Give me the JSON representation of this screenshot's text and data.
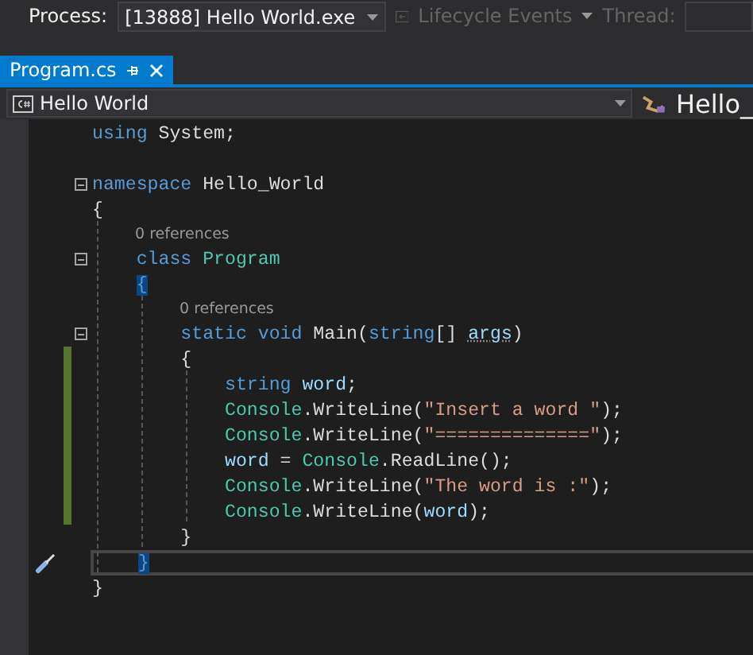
{
  "toolbar": {
    "process_label": "Process:",
    "process": "[13888] Hello World.exe",
    "lifecycle": {
      "label": "Lifecycle Events",
      "disabled": true
    },
    "thread_label": {
      "label": "Thread:",
      "disabled": true
    }
  },
  "tabs": [
    {
      "label": "Program.cs",
      "selected": true
    }
  ],
  "nav": {
    "project": "Hello World",
    "member": "Hello_"
  },
  "lines": [
    {
      "kind": "code",
      "tokens": [
        {
          "text": "using",
          "kind": "kw"
        },
        {
          "text": " System;",
          "kind": "id"
        }
      ]
    },
    {
      "kind": "blank"
    },
    {
      "kind": "code",
      "fold": true,
      "tokens": [
        {
          "text": "namespace",
          "kind": "kw"
        },
        {
          "text": " Hello_World",
          "kind": "id"
        }
      ]
    },
    {
      "kind": "code",
      "tokens": [
        {
          "text": "{",
          "kind": "id"
        }
      ]
    },
    {
      "kind": "lens",
      "text": "0 references"
    },
    {
      "kind": "code",
      "fold": true,
      "tokens": [
        {
          "text": "    class",
          "kind": "kw"
        },
        {
          "text": " Program",
          "kind": "type"
        }
      ]
    },
    {
      "kind": "code",
      "tokens": [
        {
          "text": "    {",
          "kind": "match"
        }
      ]
    },
    {
      "kind": "lens",
      "text": "0 references"
    },
    {
      "kind": "code",
      "fold": true,
      "tokens": [
        {
          "text": "        static void",
          "kind": "kw"
        },
        {
          "text": " Main(",
          "kind": "id"
        },
        {
          "text": "string",
          "kind": "kw"
        },
        {
          "text": "[] ",
          "kind": "id"
        },
        {
          "text": "args",
          "kind": "unused"
        },
        {
          "text": ")",
          "kind": "id"
        }
      ]
    },
    {
      "kind": "code",
      "changed": true,
      "tokens": [
        {
          "text": "        {",
          "kind": "id"
        }
      ]
    },
    {
      "kind": "code",
      "changed": true,
      "tokens": [
        {
          "text": "            string",
          "kind": "kw"
        },
        {
          "text": " word",
          "kind": "local"
        },
        {
          "text": ";",
          "kind": "id"
        }
      ]
    },
    {
      "kind": "code",
      "changed": true,
      "tokens": [
        {
          "text": "            Console",
          "kind": "type"
        },
        {
          "text": ".WriteLine(",
          "kind": "id"
        },
        {
          "text": "\"Insert a word \"",
          "kind": "str"
        },
        {
          "text": ");",
          "kind": "id"
        }
      ]
    },
    {
      "kind": "code",
      "changed": true,
      "tokens": [
        {
          "text": "            Console",
          "kind": "type"
        },
        {
          "text": ".WriteLine(",
          "kind": "id"
        },
        {
          "text": "\"==============\"",
          "kind": "str"
        },
        {
          "text": ");",
          "kind": "id"
        }
      ]
    },
    {
      "kind": "code",
      "changed": true,
      "tokens": [
        {
          "text": "            word",
          "kind": "local"
        },
        {
          "text": " = ",
          "kind": "id"
        },
        {
          "text": "Console",
          "kind": "type"
        },
        {
          "text": ".ReadLine();",
          "kind": "id"
        }
      ]
    },
    {
      "kind": "code",
      "changed": true,
      "tokens": [
        {
          "text": "            Console",
          "kind": "type"
        },
        {
          "text": ".WriteLine(",
          "kind": "id"
        },
        {
          "text": "\"The word is :\"",
          "kind": "str"
        },
        {
          "text": ");",
          "kind": "id"
        }
      ]
    },
    {
      "kind": "code",
      "changed": true,
      "tokens": [
        {
          "text": "            Console",
          "kind": "type"
        },
        {
          "text": ".WriteLine(",
          "kind": "id"
        },
        {
          "text": "word",
          "kind": "local"
        },
        {
          "text": ");",
          "kind": "id"
        }
      ]
    },
    {
      "kind": "code",
      "tokens": [
        {
          "text": "        }",
          "kind": "id"
        }
      ]
    },
    {
      "kind": "code",
      "current": true,
      "tokens": [
        {
          "text": "    }",
          "kind": "match"
        }
      ]
    },
    {
      "kind": "code",
      "tokens": [
        {
          "text": "}",
          "kind": "id"
        }
      ]
    }
  ]
}
